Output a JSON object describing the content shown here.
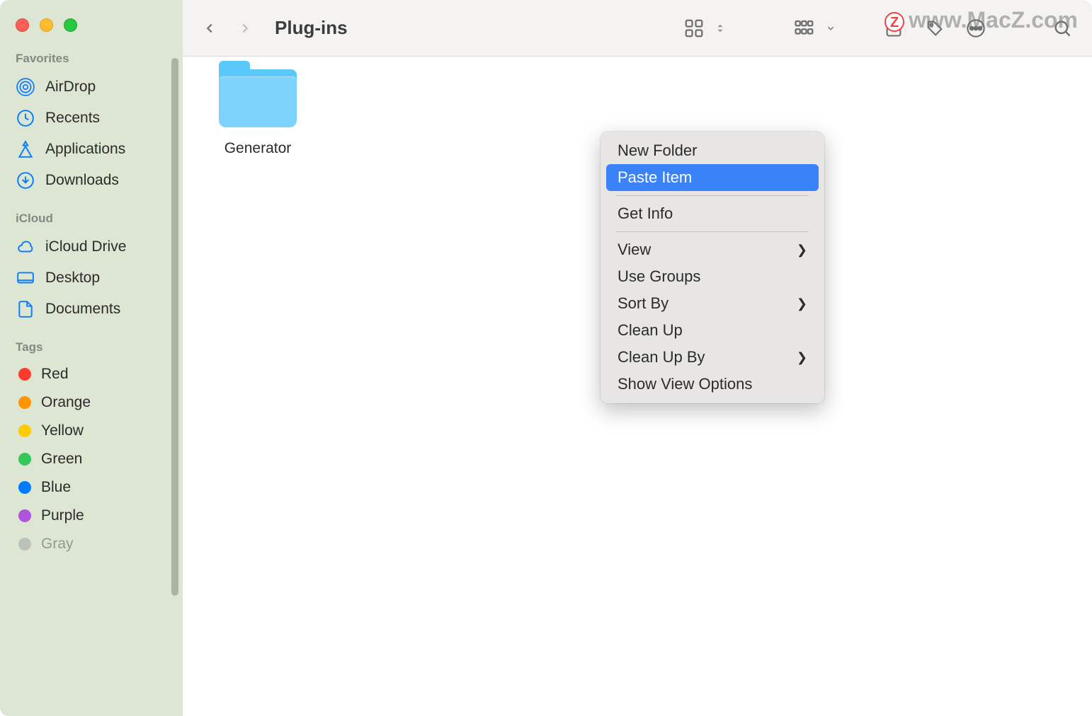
{
  "window": {
    "title": "Plug-ins"
  },
  "watermark": "www.MacZ.com",
  "sidebar": {
    "sections": {
      "favorites": {
        "title": "Favorites",
        "items": [
          {
            "label": "AirDrop",
            "icon": "airdrop-icon"
          },
          {
            "label": "Recents",
            "icon": "clock-icon"
          },
          {
            "label": "Applications",
            "icon": "apps-icon"
          },
          {
            "label": "Downloads",
            "icon": "download-icon"
          }
        ]
      },
      "icloud": {
        "title": "iCloud",
        "items": [
          {
            "label": "iCloud Drive",
            "icon": "cloud-icon"
          },
          {
            "label": "Desktop",
            "icon": "desktop-icon"
          },
          {
            "label": "Documents",
            "icon": "document-icon"
          }
        ]
      },
      "tags": {
        "title": "Tags",
        "items": [
          {
            "label": "Red",
            "color": "#ff3b30"
          },
          {
            "label": "Orange",
            "color": "#ff9500"
          },
          {
            "label": "Yellow",
            "color": "#ffcc00"
          },
          {
            "label": "Green",
            "color": "#34c759"
          },
          {
            "label": "Blue",
            "color": "#007aff"
          },
          {
            "label": "Purple",
            "color": "#af52de"
          },
          {
            "label": "Gray",
            "color": "#8e8e93"
          }
        ]
      }
    }
  },
  "content": {
    "items": [
      {
        "name": "Generator",
        "type": "folder"
      }
    ]
  },
  "context_menu": {
    "items": [
      {
        "label": "New Folder",
        "submenu": false
      },
      {
        "label": "Paste Item",
        "submenu": false,
        "highlighted": true
      },
      {
        "separator": true
      },
      {
        "label": "Get Info",
        "submenu": false
      },
      {
        "separator": true
      },
      {
        "label": "View",
        "submenu": true
      },
      {
        "label": "Use Groups",
        "submenu": false
      },
      {
        "label": "Sort By",
        "submenu": true
      },
      {
        "label": "Clean Up",
        "submenu": false
      },
      {
        "label": "Clean Up By",
        "submenu": true
      },
      {
        "label": "Show View Options",
        "submenu": false
      }
    ]
  },
  "toolbar_icons": {
    "back": "back",
    "forward": "forward",
    "view_mode": "icon-view",
    "group": "group-by",
    "share": "share",
    "tag": "tag",
    "action": "action",
    "search": "search"
  }
}
